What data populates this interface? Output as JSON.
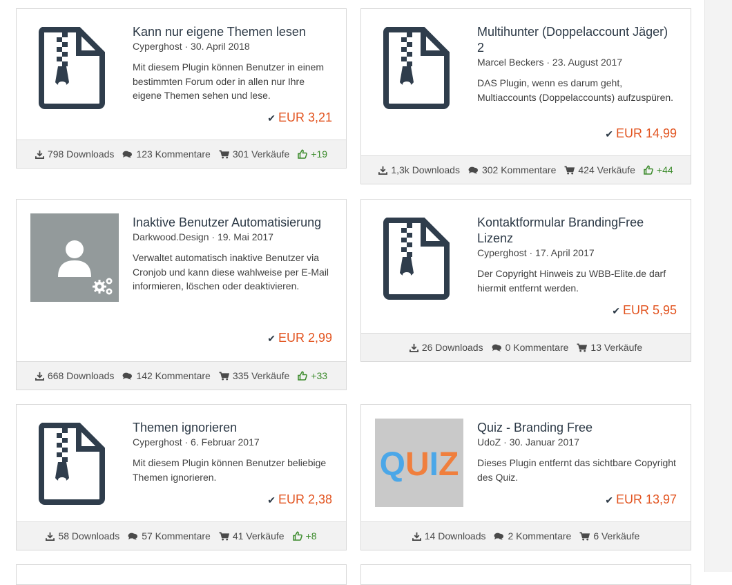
{
  "items": [
    {
      "title": "Kann nur eigene Themen lesen",
      "author": "Cyperghost",
      "date": "30. April 2018",
      "description": "Mit diesem Plugin können Benutzer in einem bestimmten Forum oder in allen nur Ihre eigene Themen sehen und lese.",
      "price": "EUR 3,21",
      "downloads": "798 Downloads",
      "comments": "123 Kommentare",
      "sales": "301 Verkäufe",
      "likes": "+19",
      "icon": "zip-file-icon"
    },
    {
      "title": "Multihunter (Doppelaccount Jäger) 2",
      "author": "Marcel Beckers",
      "date": "23. August 2017",
      "description": "DAS Plugin, wenn es darum geht, Multiaccounts (Doppelaccounts) aufzuspüren.",
      "price": "EUR 14,99",
      "downloads": "1,3k Downloads",
      "comments": "302 Kommentare",
      "sales": "424 Verkäufe",
      "likes": "+44",
      "icon": "zip-file-icon"
    },
    {
      "title": "Inaktive Benutzer Automatisierung",
      "author": "Darkwood.Design",
      "date": "19. Mai 2017",
      "description": "Verwaltet automatisch inaktive Benutzer via Cronjob und kann diese wahlweise per E-Mail informieren, löschen oder deaktivieren.",
      "price": "EUR 2,99",
      "downloads": "668 Downloads",
      "comments": "142 Kommentare",
      "sales": "335 Verkäufe",
      "likes": "+33",
      "icon": "user-gear-icon"
    },
    {
      "title": "Kontaktformular BrandingFree Lizenz",
      "author": "Cyperghost",
      "date": "17. April 2017",
      "description": "Der Copyright Hinweis zu WBB-Elite.de darf hiermit entfernt werden.",
      "price": "EUR 5,95",
      "downloads": "26 Downloads",
      "comments": "0 Kommentare",
      "sales": "13 Verkäufe",
      "likes": "",
      "icon": "zip-file-icon"
    },
    {
      "title": "Themen ignorieren",
      "author": "Cyperghost",
      "date": "6. Februar 2017",
      "description": "Mit diesem Plugin können Benutzer beliebige Themen ignorieren.",
      "price": "EUR 2,38",
      "downloads": "58 Downloads",
      "comments": "57 Kommentare",
      "sales": "41 Verkäufe",
      "likes": "+8",
      "icon": "zip-file-icon"
    },
    {
      "title": "Quiz - Branding Free",
      "author": "UdoZ",
      "date": "30. Januar 2017",
      "description": "Dieses Plugin entfernt das sichtbare Copyright des Quiz.",
      "price": "EUR 13,97",
      "downloads": "14 Downloads",
      "comments": "2 Kommentare",
      "sales": "6 Verkäufe",
      "likes": "",
      "icon": "quiz-logo",
      "logo_text": "QUIZ"
    }
  ],
  "separator": "·",
  "colors": {
    "price": "#e25420",
    "title": "#2b3845",
    "likes": "#3a8a2a"
  }
}
